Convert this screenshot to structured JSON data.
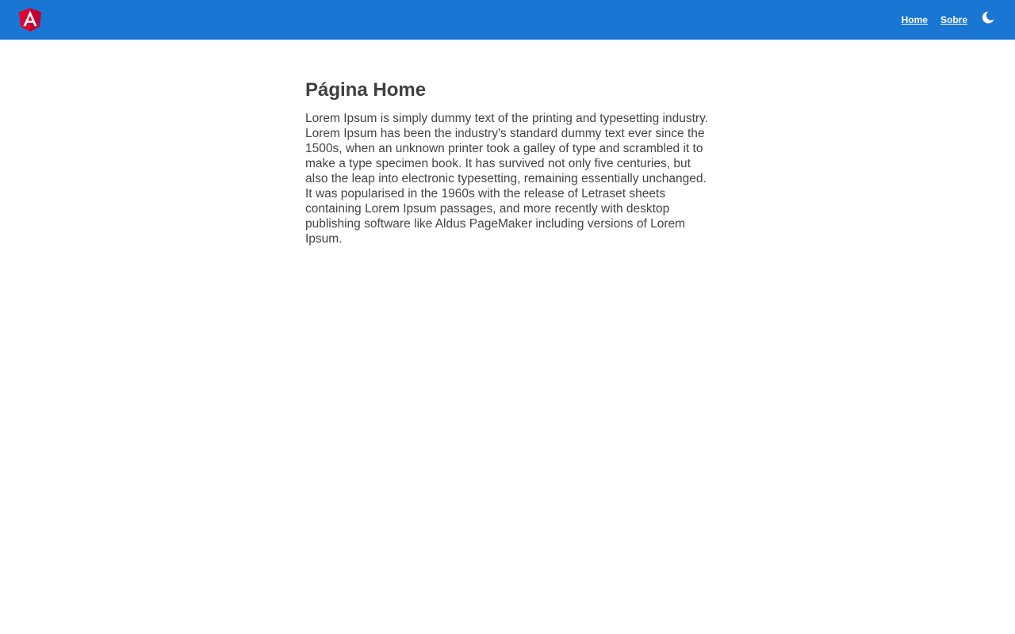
{
  "header": {
    "logo_icon": "angular-logo-icon",
    "nav": [
      {
        "label": "Home"
      },
      {
        "label": "Sobre"
      }
    ],
    "theme_toggle_icon": "moon-icon",
    "colors": {
      "toolbar_bg": "#1976d2",
      "logo_red": "#dd0031",
      "logo_dark_red": "#c3002f"
    }
  },
  "main": {
    "title": "Página Home",
    "body": "Lorem Ipsum is simply dummy text of the printing and typesetting industry. Lorem Ipsum has been the industry's standard dummy text ever since the 1500s, when an unknown printer took a galley of type and scrambled it to make a type specimen book. It has survived not only five centuries, but also the leap into electronic typesetting, remaining essentially unchanged. It was popularised in the 1960s with the release of Letraset sheets containing Lorem Ipsum passages, and more recently with desktop publishing software like Aldus PageMaker including versions of Lorem Ipsum."
  }
}
